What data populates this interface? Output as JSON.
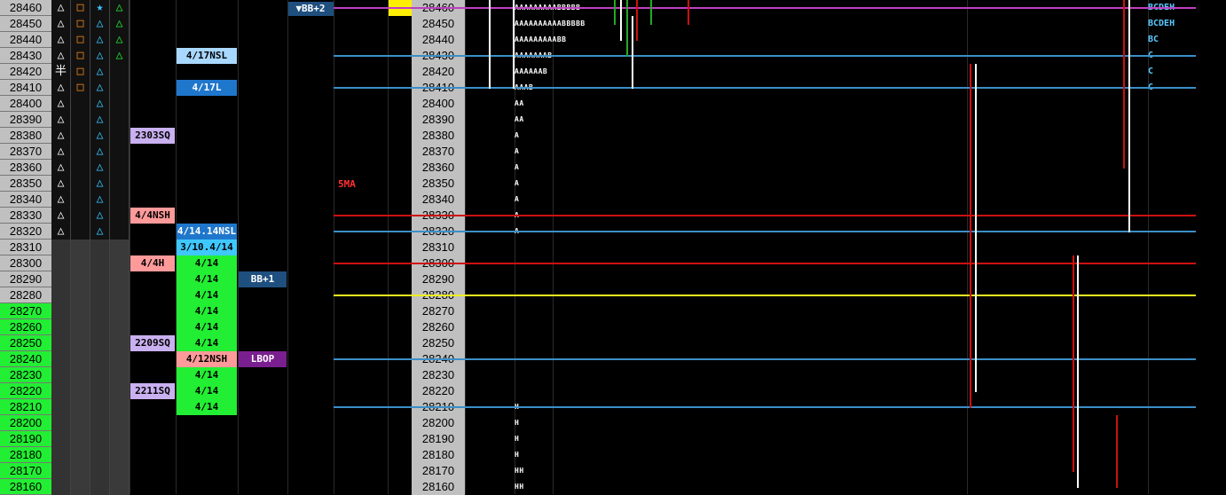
{
  "colors": {
    "price_grey": "#c0c0c0",
    "price_green": "#22ee33",
    "magenta": "#c040c0",
    "blue_line": "#3a8fc8",
    "red_line": "#cc1111",
    "yellow_line": "#eeee22"
  },
  "prices": [
    "28460",
    "28450",
    "28440",
    "28430",
    "28420",
    "28410",
    "28400",
    "28390",
    "28380",
    "28370",
    "28360",
    "28350",
    "28340",
    "28330",
    "28320",
    "28310",
    "28300",
    "28290",
    "28280",
    "28270",
    "28260",
    "28250",
    "28240",
    "28230",
    "28220",
    "28210",
    "28200",
    "28190",
    "28180",
    "28170",
    "28160"
  ],
  "green_start_index": 19,
  "symbols": [
    [
      "△",
      "□",
      "★",
      "△"
    ],
    [
      "△",
      "□",
      "△",
      "△"
    ],
    [
      "△",
      "□",
      "△",
      "△"
    ],
    [
      "△",
      "□",
      "△",
      "△"
    ],
    [
      "半",
      "□",
      "△",
      ""
    ],
    [
      "△",
      "□",
      "△",
      ""
    ],
    [
      "△",
      "",
      "△",
      ""
    ],
    [
      "△",
      "",
      "△",
      ""
    ],
    [
      "△",
      "",
      "△",
      ""
    ],
    [
      "△",
      "",
      "△",
      ""
    ],
    [
      "△",
      "",
      "△",
      ""
    ],
    [
      "△",
      "",
      "△",
      ""
    ],
    [
      "△",
      "",
      "△",
      ""
    ],
    [
      "△",
      "",
      "△",
      ""
    ],
    [
      "△",
      "",
      "△",
      ""
    ]
  ],
  "labels": [
    {
      "row": 3,
      "col": "c6",
      "text": "4/17NSL",
      "color": "#a9d8ff",
      "fg": "#000"
    },
    {
      "row": 5,
      "col": "c6",
      "text": "4/17L",
      "color": "#1f77cc",
      "fg": "#fff"
    },
    {
      "row": 8,
      "col": "c5",
      "text": "2303SQ",
      "color": "#c9b0f0",
      "fg": "#000"
    },
    {
      "row": 13,
      "col": "c5",
      "text": "4/4NSH",
      "color": "#ff9a9a",
      "fg": "#000"
    },
    {
      "row": 14,
      "col": "c6",
      "text": "4/14.14NSL",
      "color": "#1f77cc",
      "fg": "#fff"
    },
    {
      "row": 15,
      "col": "c6",
      "text": "3/10.4/14",
      "color": "#3ec8ff",
      "fg": "#000"
    },
    {
      "row": 16,
      "col": "c5",
      "text": "4/4H",
      "color": "#ff9a9a",
      "fg": "#000"
    },
    {
      "row": 16,
      "col": "c6",
      "text": "4/14",
      "color": "#22ee33",
      "fg": "#000"
    },
    {
      "row": 17,
      "col": "c6",
      "text": "4/14",
      "color": "#22ee33",
      "fg": "#000"
    },
    {
      "row": 17,
      "col": "c7",
      "text": "BB+1",
      "color": "#1f4f7f",
      "fg": "#fff"
    },
    {
      "row": 18,
      "col": "c6",
      "text": "4/14",
      "color": "#22ee33",
      "fg": "#000"
    },
    {
      "row": 19,
      "col": "c6",
      "text": "4/14",
      "color": "#22ee33",
      "fg": "#000"
    },
    {
      "row": 20,
      "col": "c6",
      "text": "4/14",
      "color": "#22ee33",
      "fg": "#000"
    },
    {
      "row": 21,
      "col": "c5",
      "text": "2209SQ",
      "color": "#c9b0f0",
      "fg": "#000"
    },
    {
      "row": 21,
      "col": "c6",
      "text": "4/14",
      "color": "#22ee33",
      "fg": "#000"
    },
    {
      "row": 22,
      "col": "c6",
      "text": "4/12NSH",
      "color": "#ff9a9a",
      "fg": "#000"
    },
    {
      "row": 22,
      "col": "c7",
      "text": "LBOP",
      "color": "#7a1f8f",
      "fg": "#fff"
    },
    {
      "row": 23,
      "col": "c6",
      "text": "4/14",
      "color": "#22ee33",
      "fg": "#000"
    },
    {
      "row": 24,
      "col": "c5",
      "text": "2211SQ",
      "color": "#c9b0f0",
      "fg": "#000"
    },
    {
      "row": 24,
      "col": "c6",
      "text": "4/14",
      "color": "#22ee33",
      "fg": "#000"
    },
    {
      "row": 25,
      "col": "c6",
      "text": "4/14",
      "color": "#22ee33",
      "fg": "#000"
    }
  ],
  "top_tag": "▼BB+2",
  "sma_label": "5MA",
  "tpo": [
    "AAAAAAAAABBBBB",
    "AAAAAAAAAABBBBB",
    "AAAAAAAAABB",
    "AAAAAAAB",
    "AAAAAAB",
    "AAAB",
    "AA",
    "AA",
    "A",
    "A",
    "A",
    "A",
    "A",
    "A",
    "A",
    "",
    "",
    "",
    "",
    "",
    "",
    "",
    "",
    "",
    "",
    "H",
    "H",
    "H",
    "H",
    "HH",
    "HH"
  ],
  "right_labels": [
    "BCDEH",
    "BCDEH",
    "BC",
    "C",
    "C",
    "C"
  ],
  "hlines": [
    {
      "row": 0,
      "color": "#c040c0"
    },
    {
      "row": 3,
      "color": "#3a8fc8"
    },
    {
      "row": 5,
      "color": "#3a8fc8"
    },
    {
      "row": 13,
      "color": "#cc1111"
    },
    {
      "row": 14,
      "color": "#3a8fc8"
    },
    {
      "row": 16,
      "color": "#cc1111"
    },
    {
      "row": 18,
      "color": "#eeee22"
    },
    {
      "row": 22,
      "color": "#3a8fc8"
    },
    {
      "row": 25,
      "color": "#3a8fc8"
    }
  ],
  "wicks": [
    {
      "col": 0,
      "r1": 0,
      "r2": 5,
      "color": "#ffffff"
    },
    {
      "col": 1,
      "r1": 0,
      "r2": 5,
      "color": "#ffffff"
    },
    {
      "col": 2,
      "r1": 0,
      "r2": 1,
      "color": "#22aa22"
    },
    {
      "col": 3,
      "r1": 0,
      "r2": 2,
      "color": "#ffffff"
    },
    {
      "col": 4,
      "r1": 0,
      "r2": 3,
      "color": "#22aa22"
    },
    {
      "col": 5,
      "r1": 1,
      "r2": 5,
      "color": "#ffffff"
    },
    {
      "col": 6,
      "r1": 0,
      "r2": 2,
      "color": "#cc1111"
    },
    {
      "col": 7,
      "r1": 0,
      "r2": 1,
      "color": "#22aa22"
    },
    {
      "col": 8,
      "r1": 0,
      "r2": 1,
      "color": "#cc1111"
    },
    {
      "col": 9,
      "r1": 4,
      "r2": 25,
      "color": "#cc1111"
    },
    {
      "col": 10,
      "r1": 4,
      "r2": 24,
      "color": "#ffffff"
    },
    {
      "col": 11,
      "r1": 16,
      "r2": 29,
      "color": "#cc1111"
    },
    {
      "col": 12,
      "r1": 16,
      "r2": 30,
      "color": "#ffffff"
    },
    {
      "col": 13,
      "r1": 0,
      "r2": 10,
      "color": "#cc1111"
    },
    {
      "col": 14,
      "r1": 0,
      "r2": 14,
      "color": "#ffffff"
    },
    {
      "col": 15,
      "r1": 26,
      "r2": 30,
      "color": "#cc1111"
    }
  ]
}
